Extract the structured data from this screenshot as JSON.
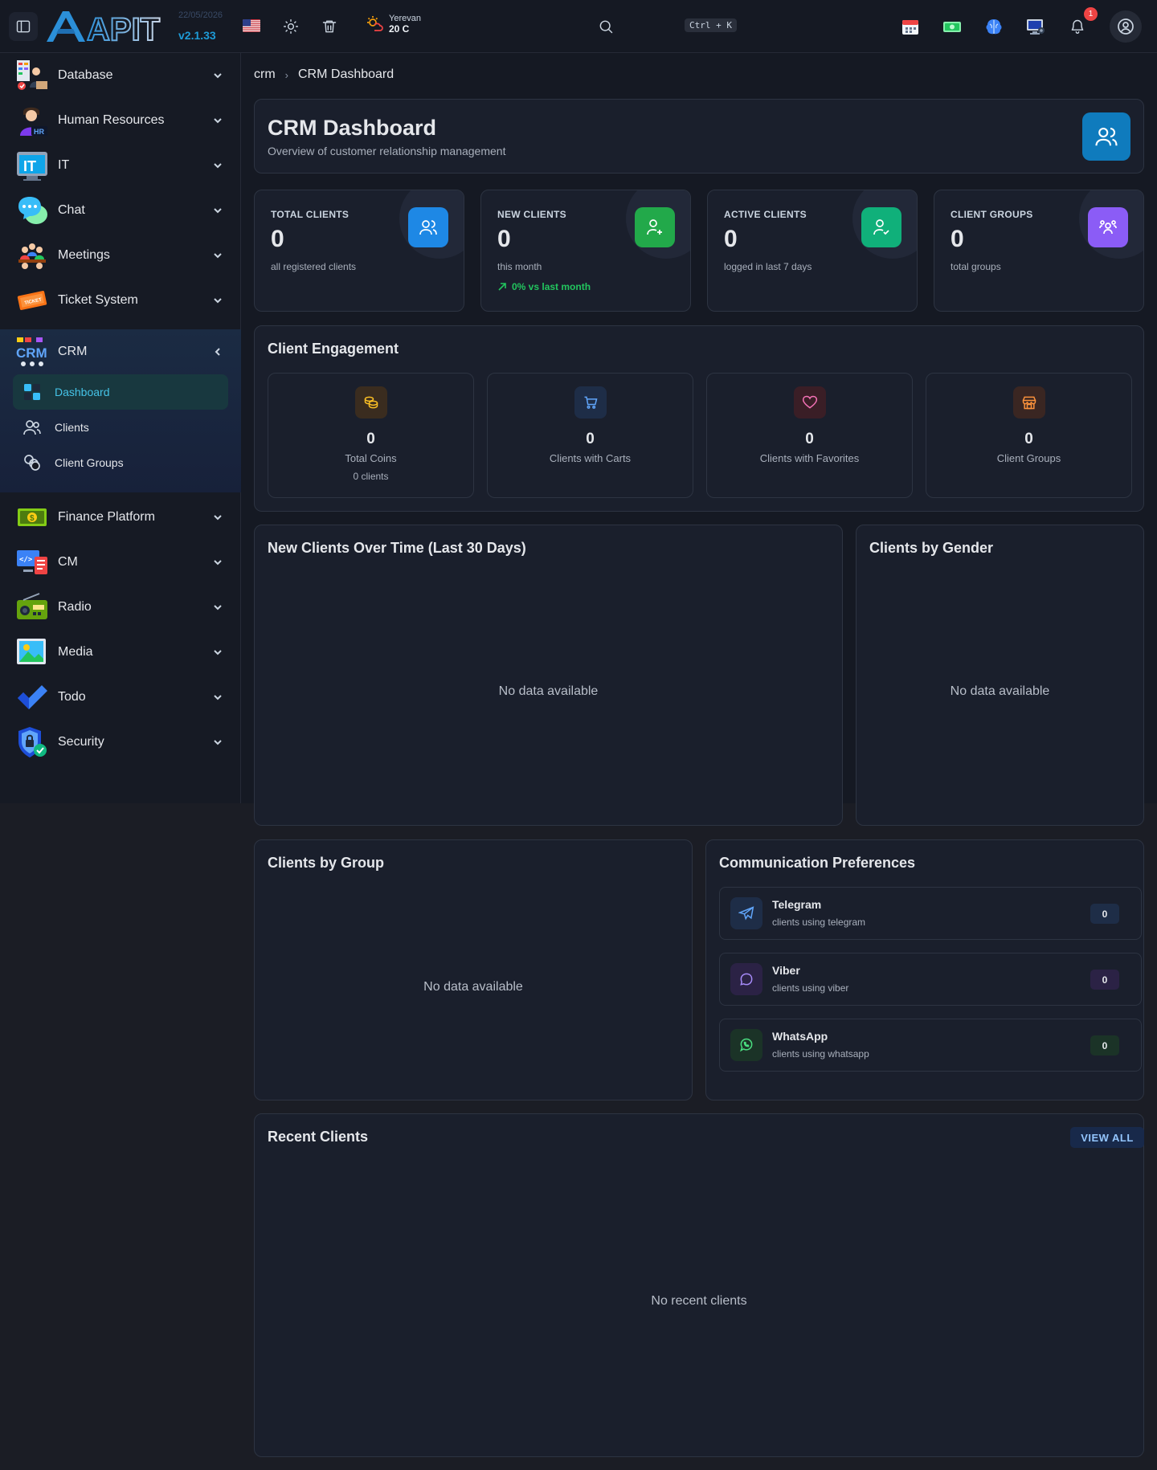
{
  "header": {
    "logo_text": "APIT",
    "date": "22/05/2026",
    "version": "v2.1.33",
    "weather": {
      "city": "Yerevan",
      "temp": "20 C"
    },
    "shortcut": "Ctrl + K",
    "notification_count": "1"
  },
  "sidebar": {
    "items": [
      {
        "label": "Database",
        "icon": "database-icon"
      },
      {
        "label": "Human Resources",
        "icon": "human-resources-icon"
      },
      {
        "label": "IT",
        "icon": "it-icon"
      },
      {
        "label": "Chat",
        "icon": "chat-icon"
      },
      {
        "label": "Meetings",
        "icon": "meetings-icon"
      },
      {
        "label": "Ticket System",
        "icon": "ticket-icon"
      },
      {
        "label": "CRM",
        "icon": "crm-icon"
      },
      {
        "label": "Finance Platform",
        "icon": "finance-icon"
      },
      {
        "label": "CM",
        "icon": "cm-icon"
      },
      {
        "label": "Radio",
        "icon": "radio-icon"
      },
      {
        "label": "Media",
        "icon": "media-icon"
      },
      {
        "label": "Todo",
        "icon": "todo-icon"
      },
      {
        "label": "Security",
        "icon": "security-icon"
      }
    ],
    "crm_sub": [
      {
        "label": "Dashboard",
        "icon": "dashboard-icon"
      },
      {
        "label": "Clients",
        "icon": "clients-icon"
      },
      {
        "label": "Client Groups",
        "icon": "client-groups-icon"
      }
    ]
  },
  "breadcrumb": {
    "root": "crm",
    "current": "CRM Dashboard"
  },
  "page": {
    "title": "CRM Dashboard",
    "subtitle": "Overview of customer relationship management"
  },
  "stats": [
    {
      "label": "TOTAL CLIENTS",
      "value": "0",
      "sub": "all registered clients",
      "color": "#1e88e5"
    },
    {
      "label": "NEW CLIENTS",
      "value": "0",
      "sub": "this month",
      "trend": "0% vs last month",
      "color": "#22a94a"
    },
    {
      "label": "ACTIVE CLIENTS",
      "value": "0",
      "sub": "logged in last 7 days",
      "color": "#10b07a"
    },
    {
      "label": "CLIENT GROUPS",
      "value": "0",
      "sub": "total groups",
      "color": "#8b5cf6"
    }
  ],
  "engagement": {
    "title": "Client Engagement",
    "items": [
      {
        "value": "0",
        "label": "Total Coins",
        "sub": "0 clients",
        "icon": "coins-icon"
      },
      {
        "value": "0",
        "label": "Clients with Carts",
        "icon": "cart-icon"
      },
      {
        "value": "0",
        "label": "Clients with Favorites",
        "icon": "heart-icon"
      },
      {
        "value": "0",
        "label": "Client Groups",
        "icon": "store-icon"
      }
    ]
  },
  "charts": {
    "new_clients": {
      "title": "New Clients Over Time (Last 30 Days)",
      "empty": "No data available"
    },
    "gender": {
      "title": "Clients by Gender",
      "empty": "No data available"
    },
    "group": {
      "title": "Clients by Group",
      "empty": "No data available"
    }
  },
  "communication": {
    "title": "Communication Preferences",
    "items": [
      {
        "name": "Telegram",
        "sub": "clients using telegram",
        "count": "0"
      },
      {
        "name": "Viber",
        "sub": "clients using viber",
        "count": "0"
      },
      {
        "name": "WhatsApp",
        "sub": "clients using whatsapp",
        "count": "0"
      }
    ]
  },
  "recent": {
    "title": "Recent Clients",
    "view_all": "VIEW ALL",
    "empty": "No recent clients"
  }
}
